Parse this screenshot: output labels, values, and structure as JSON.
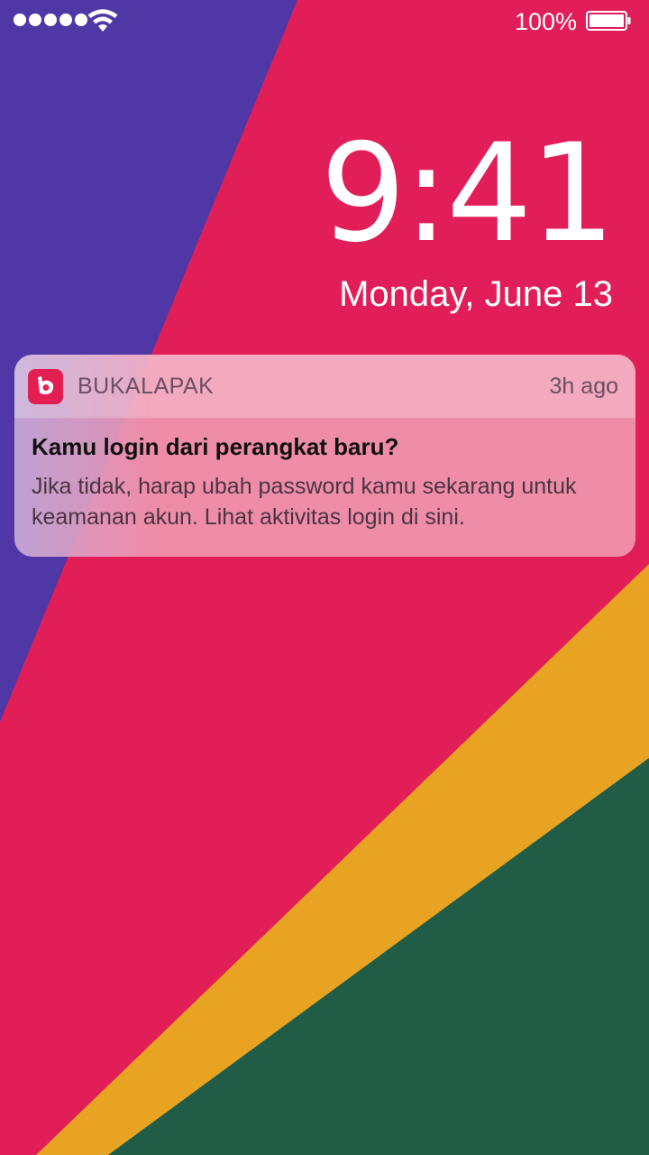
{
  "status_bar": {
    "signal_dots": 5,
    "wifi_icon": "wifi-icon",
    "battery_percent": "100%",
    "battery_icon": "battery-icon"
  },
  "lock_screen": {
    "time": "9:41",
    "date": "Monday, June 13"
  },
  "notification": {
    "app_icon": "bukalapak-logo-icon",
    "app_name": "BUKALAPAK",
    "time_ago": "3h ago",
    "title": "Kamu login dari perangkat baru?",
    "body": "Jika tidak, harap ubah password kamu sekarang untuk keamanan akun. Lihat aktivitas login di sini."
  },
  "colors": {
    "wallpaper_purple": "#4f37a6",
    "wallpaper_pink": "#e11e58",
    "wallpaper_yellow": "#e8a322",
    "wallpaper_green": "#215c47",
    "brand": "#e31e52"
  }
}
